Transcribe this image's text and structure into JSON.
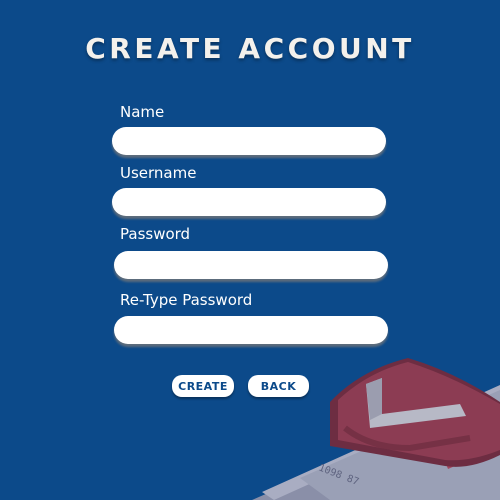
{
  "page": {
    "title": "CREATE ACCOUNT"
  },
  "form": {
    "name": {
      "label": "Name",
      "value": ""
    },
    "username": {
      "label": "Username",
      "value": ""
    },
    "password": {
      "label": "Password",
      "value": ""
    },
    "retype_password": {
      "label": "Re-Type Password",
      "value": ""
    }
  },
  "buttons": {
    "create_label": "CREATE",
    "back_label": "BACK"
  },
  "illustration": {
    "card_number_text": "1098 87"
  },
  "colors": {
    "background": "#0c4a8a",
    "title_text": "#f4f1ec",
    "button_text": "#0c4a8a",
    "shield": "#8c3c53",
    "card": "#9aa0b6"
  },
  "icons": [
    "shield-icon",
    "credit-card-icon"
  ]
}
